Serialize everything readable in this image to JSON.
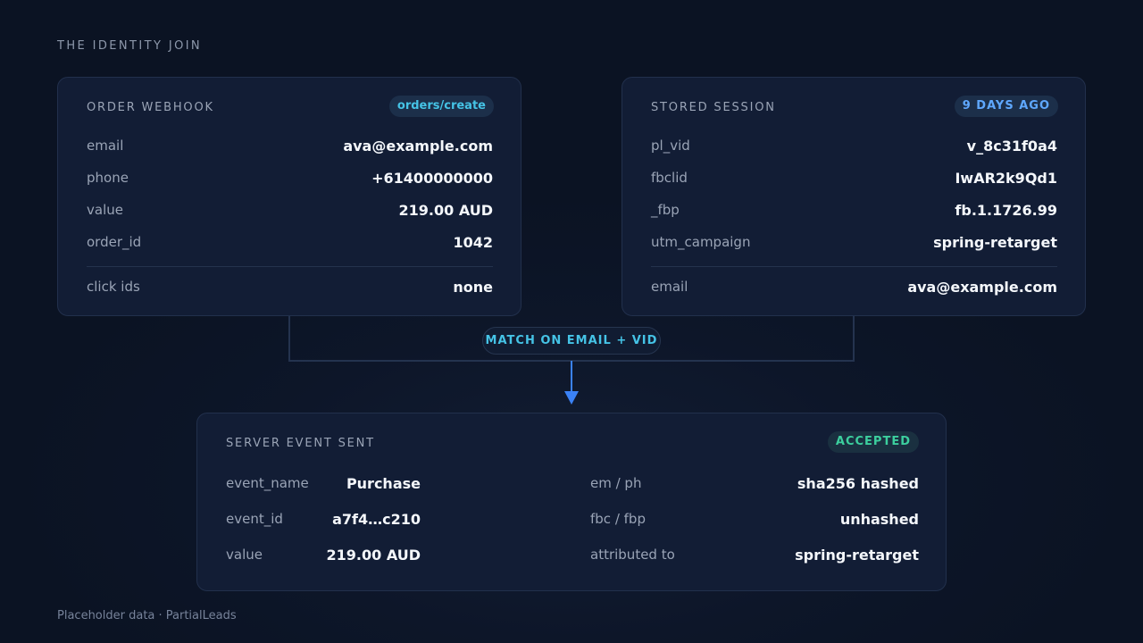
{
  "header": {
    "title": "THE IDENTITY JOIN"
  },
  "webhook": {
    "title": "ORDER WEBHOOK",
    "badge": "orders/create",
    "rows": [
      {
        "label": "email",
        "value": "ava@example.com"
      },
      {
        "label": "phone",
        "value": "+61400000000"
      },
      {
        "label": "value",
        "value": "219.00 AUD"
      },
      {
        "label": "order_id",
        "value": "1042"
      },
      {
        "label": "click ids",
        "value": "none"
      }
    ]
  },
  "session": {
    "title": "STORED SESSION",
    "badge": "9 DAYS AGO",
    "rows": [
      {
        "label": "pl_vid",
        "value": "v_8c31f0a4"
      },
      {
        "label": "fbclid",
        "value": "IwAR2k9Qd1"
      },
      {
        "label": "_fbp",
        "value": "fb.1.1726.99"
      },
      {
        "label": "utm_campaign",
        "value": "spring-retarget"
      },
      {
        "label": "email",
        "value": "ava@example.com"
      }
    ]
  },
  "match": {
    "label": "MATCH ON EMAIL + VID"
  },
  "event": {
    "title": "SERVER EVENT SENT",
    "badge": "ACCEPTED",
    "left": [
      {
        "label": "event_name",
        "value": "Purchase"
      },
      {
        "label": "event_id",
        "value": "a7f4…c210"
      },
      {
        "label": "value",
        "value": "219.00 AUD"
      }
    ],
    "right": [
      {
        "label": "em / ph",
        "value": "sha256 hashed"
      },
      {
        "label": "fbc / fbp",
        "value": "unhashed"
      },
      {
        "label": "attributed to",
        "value": "spring-retarget"
      }
    ]
  },
  "footer": {
    "text": "Placeholder data · PartialLeads"
  },
  "colors": {
    "background": "#0b1323",
    "card": "#121d35",
    "accent_cyan": "#45c3e6",
    "accent_blue": "#3b82f6",
    "accent_green": "#3ccf9e"
  }
}
